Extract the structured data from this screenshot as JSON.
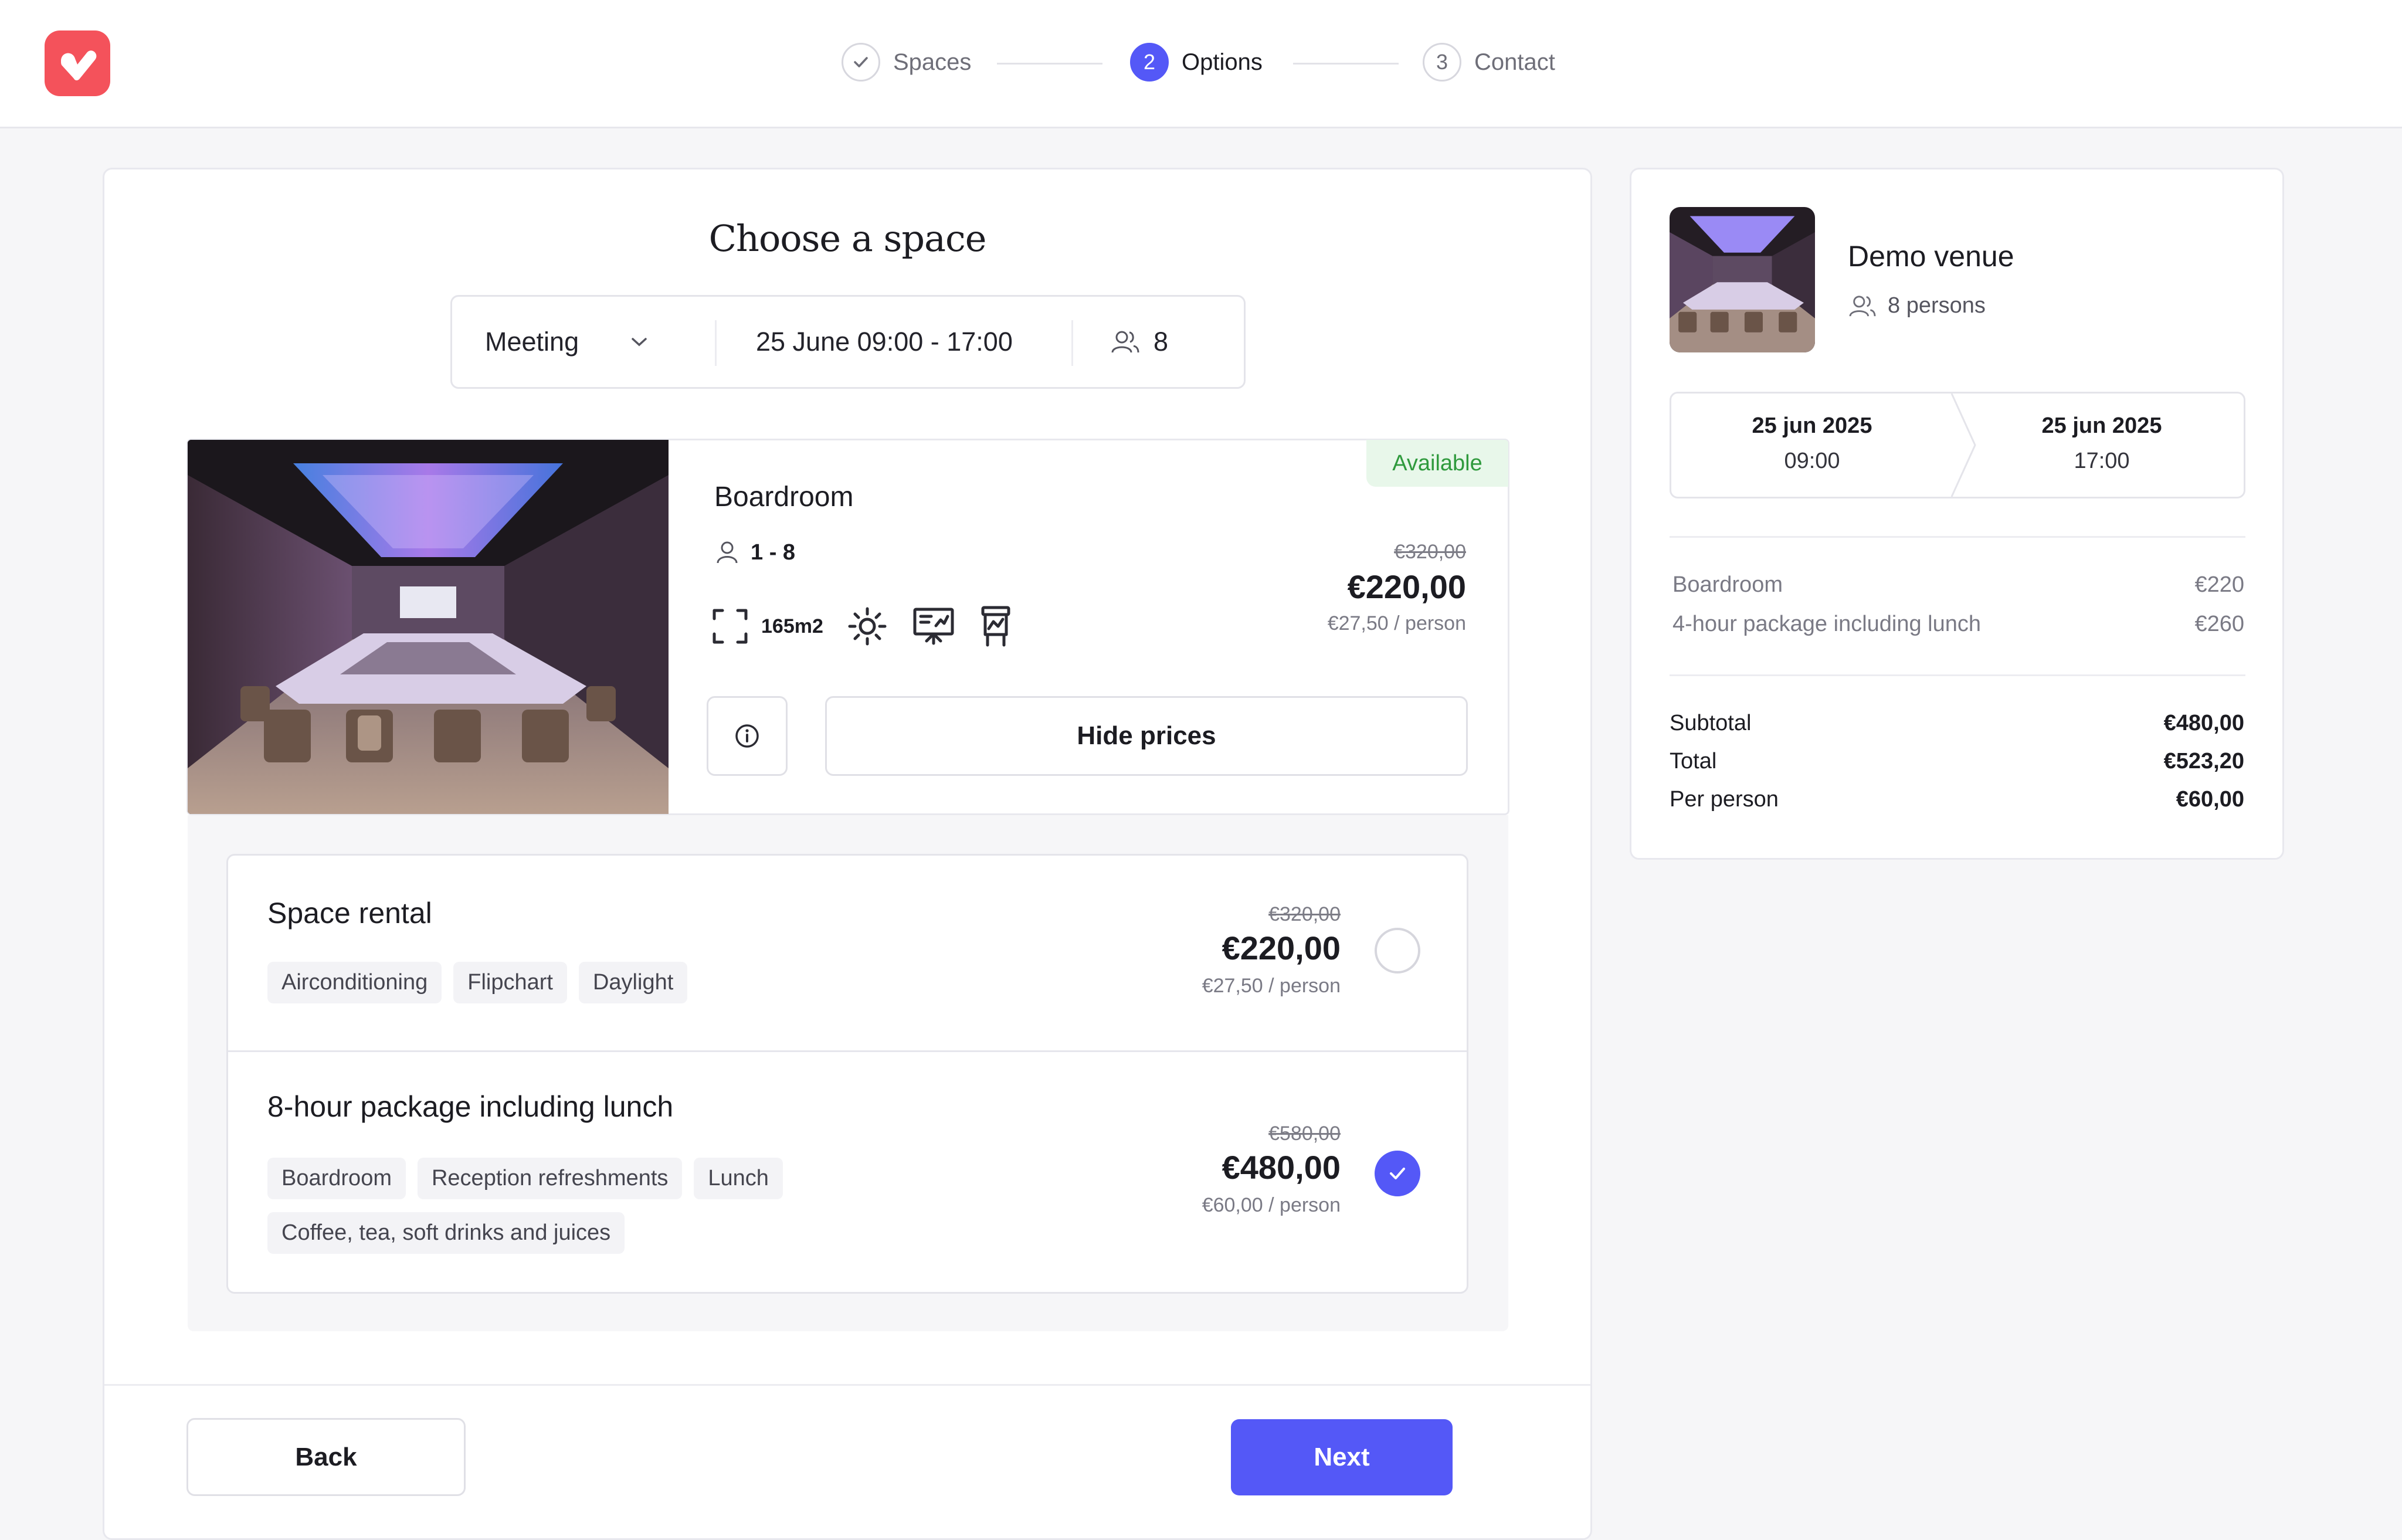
{
  "stepper": {
    "steps": [
      {
        "label": "Spaces",
        "marker": "✓"
      },
      {
        "label": "Options",
        "marker": "2"
      },
      {
        "label": "Contact",
        "marker": "3"
      }
    ]
  },
  "main": {
    "title": "Choose a space",
    "filters": {
      "type": "Meeting",
      "datetime": "25 June 09:00 - 17:00",
      "persons": "8"
    },
    "space": {
      "name": "Boardroom",
      "badge": "Available",
      "capacity": "1 - 8",
      "area": "165m2",
      "price_old": "€320,00",
      "price": "€220,00",
      "per_person": "€27,50 / person",
      "hide_prices_label": "Hide prices"
    },
    "options": [
      {
        "title": "Space rental",
        "chips": [
          "Airconditioning",
          "Flipchart",
          "Daylight"
        ],
        "price_old": "€320,00",
        "price": "€220,00",
        "per_person": "€27,50 / person",
        "selected": false
      },
      {
        "title": "8-hour package including lunch",
        "chips": [
          "Boardroom",
          "Reception refreshments",
          "Lunch",
          "Coffee, tea, soft drinks and juices"
        ],
        "price_old": "€580,00",
        "price": "€480,00",
        "per_person": "€60,00 / person",
        "selected": true
      }
    ],
    "back_label": "Back",
    "next_label": "Next"
  },
  "summary": {
    "venue": "Demo venue",
    "persons": "8 persons",
    "start_date": "25 jun 2025",
    "start_time": "09:00",
    "end_date": "25 jun 2025",
    "end_time": "17:00",
    "lines": [
      {
        "label": "Boardroom",
        "value": "€220"
      },
      {
        "label": "4-hour package including lunch",
        "value": "€260"
      }
    ],
    "totals": [
      {
        "label": "Subtotal",
        "value": "€480,00"
      },
      {
        "label": "Total",
        "value": "€523,20"
      },
      {
        "label": "Per person",
        "value": "€60,00"
      }
    ]
  },
  "colors": {
    "accent": "#5458f7",
    "brand": "#f4525b",
    "available_bg": "#e8f7ea",
    "available_text": "#2f9a3d"
  }
}
